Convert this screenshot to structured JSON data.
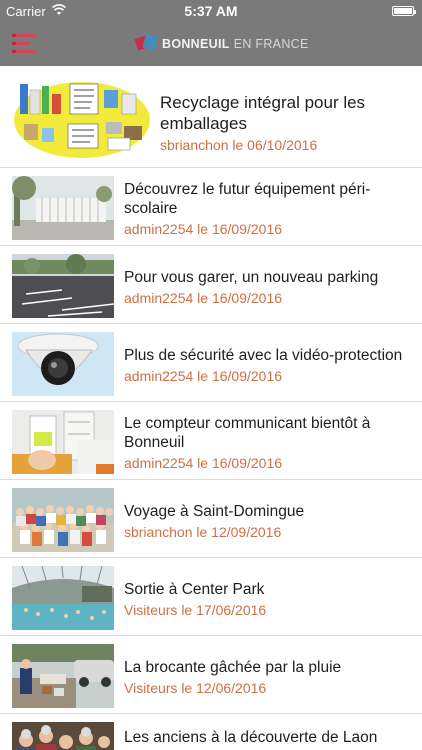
{
  "status_bar": {
    "carrier": "Carrier",
    "time": "5:37 AM"
  },
  "header": {
    "logo_name": "BONNEUIL",
    "logo_sub": "EN FRANCE"
  },
  "articles": [
    {
      "title": "Recyclage intégral pour les emballages",
      "meta": "sbrianchon le 06/10/2016",
      "image": "recycling-poster"
    },
    {
      "title": "Découvrez le futur équipement péri-scolaire",
      "meta": "admin2254 le 16/09/2016",
      "image": "building-rendering"
    },
    {
      "title": "Pour vous garer, un nouveau parking",
      "meta": "admin2254 le 16/09/2016",
      "image": "parking-lot"
    },
    {
      "title": "Plus de sécurité avec la vidéo-protection",
      "meta": "admin2254 le 16/09/2016",
      "image": "cctv-camera"
    },
    {
      "title": "Le compteur communicant bientôt à Bonneuil",
      "meta": "admin2254 le 16/09/2016",
      "image": "smart-meter"
    },
    {
      "title": "Voyage à Saint-Domingue",
      "meta": "sbrianchon le 12/09/2016",
      "image": "group-photo"
    },
    {
      "title": "Sortie à Center Park",
      "meta": "Visiteurs le 17/06/2016",
      "image": "pool-dome"
    },
    {
      "title": "La brocante gâchée par la pluie",
      "meta": "Visiteurs le 12/06/2016",
      "image": "flea-market"
    },
    {
      "title": "Les anciens à la découverte de Laon",
      "meta": "",
      "image": "elderly-group"
    }
  ],
  "colors": {
    "nav_bg": "#7a7a7a",
    "accent": "#d6435a",
    "meta_text": "#cc7145"
  }
}
